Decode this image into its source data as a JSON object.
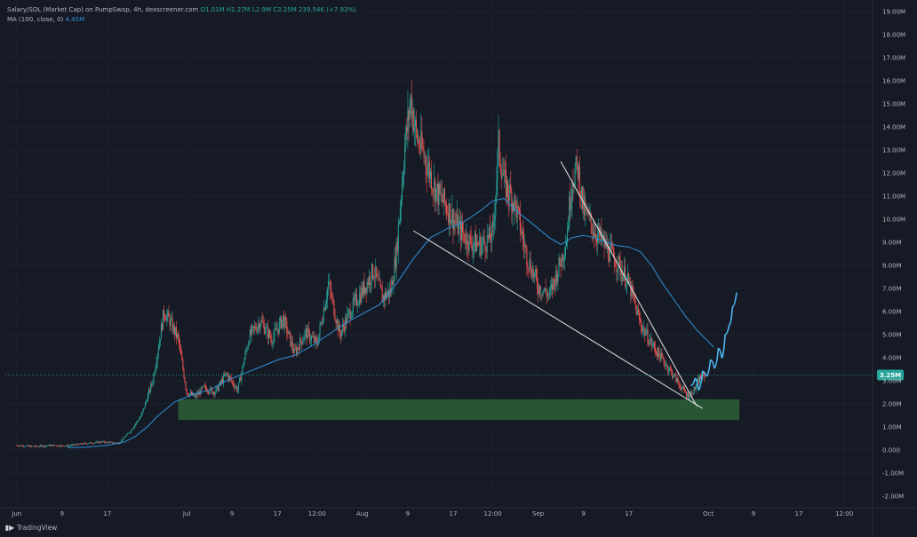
{
  "legend": {
    "title": "Salary/SOL (Market Cap) on PumpSwap, 4h, dexscreener.com",
    "ohlc": "O1.01M  H1.27M  L2.9M  C3.25M  239.54K (+7.93%)",
    "ma_label": "MA (100, close, 0)",
    "ma_value": "4.45M"
  },
  "branding": {
    "label": "TradingView",
    "icon": "tradingview-logo-icon"
  },
  "colors": {
    "background": "#161a25",
    "up": "#26a69a",
    "down": "#ef5350",
    "ma": "#2f8fd8",
    "projection": "#4fb6f0",
    "zone": "#2f6b3a",
    "price_line": "#26a69a"
  },
  "chart_data": {
    "type": "candlestick",
    "y_axis": {
      "ticks": [
        "19.00M",
        "18.00M",
        "17.00M",
        "16.00M",
        "15.00M",
        "14.00M",
        "13.00M",
        "12.00M",
        "11.00M",
        "10.00M",
        "9.00M",
        "8.00M",
        "7.00M",
        "6.00M",
        "5.00M",
        "4.00M",
        "3.00M",
        "2.00M",
        "1.00M",
        "0.000",
        "-1.00M",
        "-2.00M"
      ],
      "tick_values": [
        19,
        18,
        17,
        16,
        15,
        14,
        13,
        12,
        11,
        10,
        9,
        8,
        7,
        6,
        5,
        4,
        3,
        2,
        1,
        0,
        -1,
        -2
      ],
      "range_millions": [
        -2.5,
        19.5
      ]
    },
    "x_axis": {
      "ticks": [
        {
          "label": "Jun",
          "day": 0
        },
        {
          "label": "9",
          "day": 8
        },
        {
          "label": "17",
          "day": 16
        },
        {
          "label": "Jul",
          "day": 30
        },
        {
          "label": "9",
          "day": 38
        },
        {
          "label": "17",
          "day": 46
        },
        {
          "label": "12:00",
          "day": 53
        },
        {
          "label": "Aug",
          "day": 61
        },
        {
          "label": "9",
          "day": 69
        },
        {
          "label": "17",
          "day": 77
        },
        {
          "label": "12:00",
          "day": 84
        },
        {
          "label": "Sep",
          "day": 92
        },
        {
          "label": "9",
          "day": 100
        },
        {
          "label": "17",
          "day": 108
        },
        {
          "label": "Oct",
          "day": 122
        },
        {
          "label": "9",
          "day": 130
        },
        {
          "label": "17",
          "day": 138
        },
        {
          "label": "12:00",
          "day": 146
        }
      ],
      "range_days": [
        -2,
        151
      ]
    },
    "current_price": {
      "value": 3.25,
      "label": "3.25M"
    },
    "ma_100": {
      "name": "MA (100, close, 0)",
      "points": [
        [
          9,
          0.1
        ],
        [
          12,
          0.12
        ],
        [
          16,
          0.2
        ],
        [
          19,
          0.35
        ],
        [
          21,
          0.6
        ],
        [
          23,
          1.0
        ],
        [
          25,
          1.5
        ],
        [
          28,
          2.1
        ],
        [
          31,
          2.4
        ],
        [
          34,
          2.6
        ],
        [
          37,
          3.0
        ],
        [
          40,
          3.3
        ],
        [
          43,
          3.6
        ],
        [
          46,
          3.9
        ],
        [
          49,
          4.1
        ],
        [
          52,
          4.5
        ],
        [
          55,
          5.0
        ],
        [
          58,
          5.5
        ],
        [
          61,
          5.9
        ],
        [
          64,
          6.3
        ],
        [
          67,
          7.2
        ],
        [
          70,
          8.3
        ],
        [
          73,
          9.2
        ],
        [
          76,
          9.6
        ],
        [
          79,
          9.9
        ],
        [
          82,
          10.4
        ],
        [
          84,
          10.8
        ],
        [
          86,
          10.9
        ],
        [
          88,
          10.4
        ],
        [
          91,
          9.8
        ],
        [
          94,
          9.2
        ],
        [
          96,
          8.9
        ],
        [
          98,
          9.2
        ],
        [
          100,
          9.3
        ],
        [
          102,
          9.2
        ],
        [
          104,
          9.0
        ],
        [
          106,
          8.85
        ],
        [
          108,
          8.8
        ],
        [
          110,
          8.6
        ],
        [
          112,
          8.0
        ],
        [
          114,
          7.2
        ],
        [
          116,
          6.5
        ],
        [
          118,
          5.8
        ],
        [
          120,
          5.2
        ],
        [
          122,
          4.7
        ],
        [
          123,
          4.45
        ]
      ]
    },
    "pattern_lines": [
      {
        "name": "falling-wedge-lower",
        "from": [
          70,
          9.5
        ],
        "to": [
          121,
          1.8
        ]
      },
      {
        "name": "falling-wedge-upper",
        "from": [
          96,
          12.5
        ],
        "to": [
          120,
          1.9
        ]
      }
    ],
    "support_zone": {
      "day_from": 28.5,
      "day_to": 127.5,
      "low": 1.3,
      "high": 2.2
    },
    "projection": {
      "points": [
        [
          119,
          2.8
        ],
        [
          119.7,
          3.1
        ],
        [
          120.3,
          2.6
        ],
        [
          121,
          3.4
        ],
        [
          121.7,
          3.2
        ],
        [
          122.4,
          3.9
        ],
        [
          123.1,
          3.55
        ],
        [
          123.8,
          4.4
        ],
        [
          124.4,
          4.0
        ],
        [
          125,
          5.0
        ],
        [
          125.7,
          5.4
        ],
        [
          126.3,
          6.2
        ],
        [
          127,
          6.8
        ]
      ]
    },
    "price_anchors": [
      [
        0,
        0.2
      ],
      [
        3,
        0.15
      ],
      [
        6,
        0.2
      ],
      [
        9,
        0.18
      ],
      [
        12,
        0.28
      ],
      [
        15,
        0.35
      ],
      [
        18,
        0.3
      ],
      [
        20,
        0.8
      ],
      [
        22,
        1.5
      ],
      [
        24,
        3.0
      ],
      [
        26,
        6.0
      ],
      [
        27,
        5.6
      ],
      [
        28.5,
        4.8
      ],
      [
        30,
        2.5
      ],
      [
        31.5,
        2.3
      ],
      [
        33,
        2.7
      ],
      [
        35,
        2.5
      ],
      [
        37,
        3.3
      ],
      [
        39,
        2.6
      ],
      [
        41,
        4.9
      ],
      [
        43,
        5.6
      ],
      [
        45,
        4.8
      ],
      [
        47,
        5.7
      ],
      [
        49,
        4.2
      ],
      [
        51,
        5.1
      ],
      [
        53,
        4.6
      ],
      [
        55,
        7.2
      ],
      [
        57,
        5.0
      ],
      [
        59,
        6.1
      ],
      [
        61,
        6.9
      ],
      [
        63,
        7.8
      ],
      [
        64.5,
        6.6
      ],
      [
        66,
        6.9
      ],
      [
        67,
        8.6
      ],
      [
        68.5,
        13.2
      ],
      [
        69.5,
        15.2
      ],
      [
        70.5,
        13.6
      ],
      [
        72,
        12.7
      ],
      [
        74,
        11.2
      ],
      [
        76,
        10.5
      ],
      [
        78,
        9.6
      ],
      [
        80,
        9.0
      ],
      [
        82,
        8.9
      ],
      [
        84,
        9.3
      ],
      [
        85,
        13.2
      ],
      [
        86,
        11.6
      ],
      [
        88,
        10.6
      ],
      [
        90,
        8.4
      ],
      [
        92,
        7.1
      ],
      [
        94,
        6.7
      ],
      [
        96,
        8.2
      ],
      [
        97,
        9.2
      ],
      [
        98,
        11.8
      ],
      [
        99,
        12.2
      ],
      [
        100,
        10.4
      ],
      [
        102,
        9.5
      ],
      [
        104,
        8.8
      ],
      [
        106,
        8.1
      ],
      [
        108,
        7.2
      ],
      [
        110,
        5.5
      ],
      [
        112,
        4.6
      ],
      [
        114,
        3.9
      ],
      [
        116,
        3.2
      ],
      [
        117.5,
        2.6
      ],
      [
        118.5,
        2.35
      ],
      [
        119.5,
        2.6
      ],
      [
        120.5,
        3.1
      ],
      [
        121.5,
        3.25
      ]
    ]
  }
}
